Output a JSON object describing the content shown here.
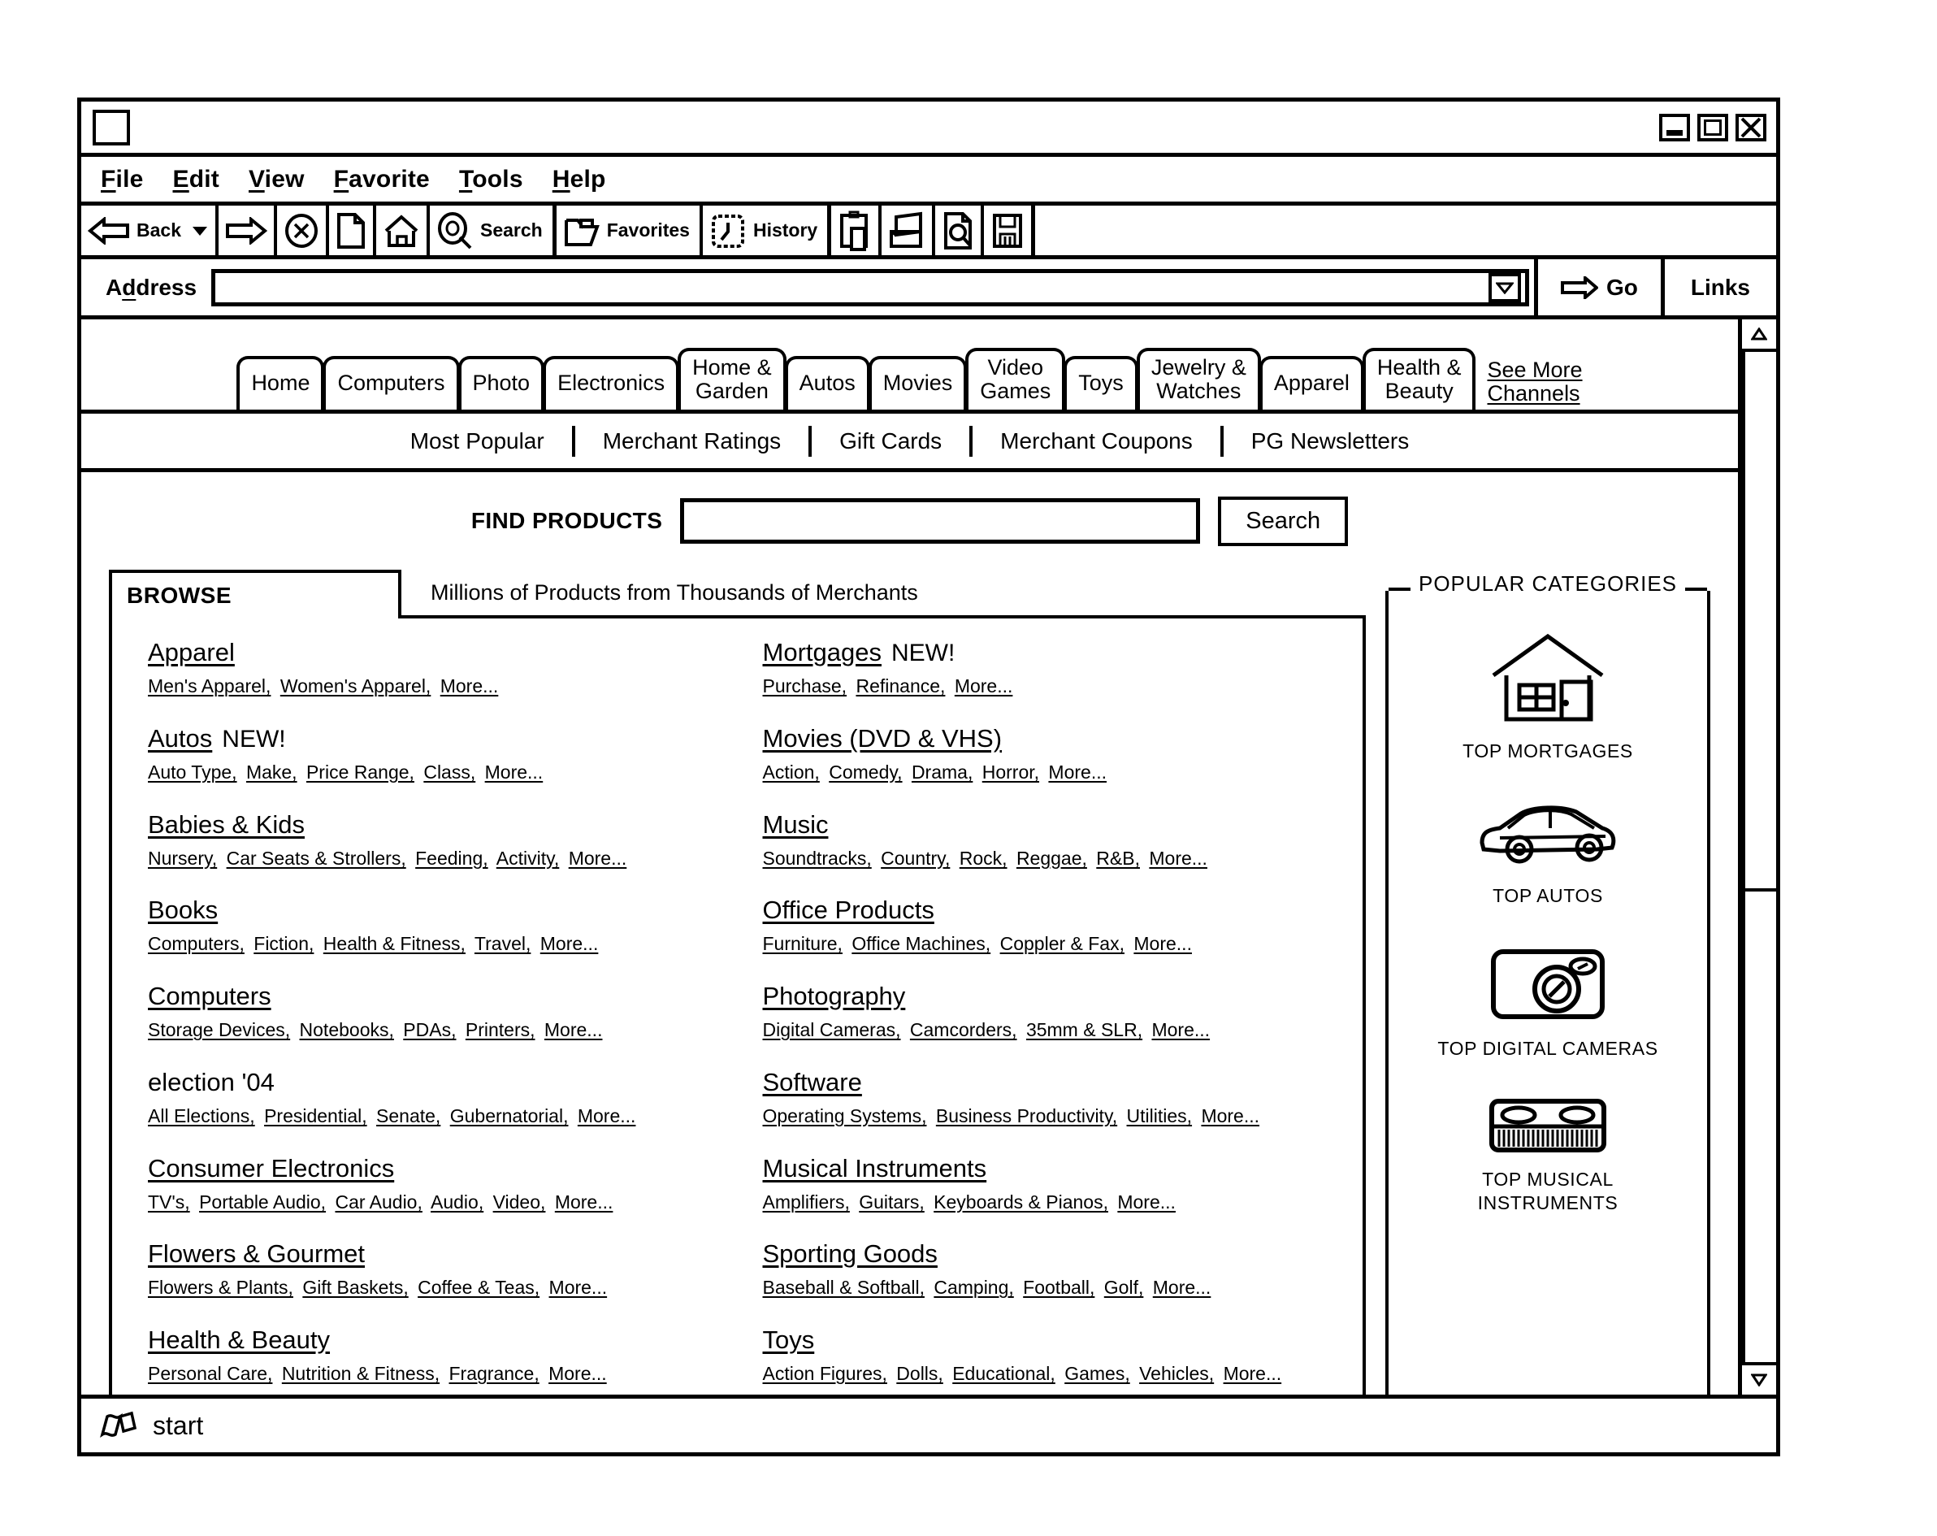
{
  "window": {
    "controls": {
      "minimize": "minimize-button",
      "maximize": "maximize-button",
      "close": "close-button"
    }
  },
  "menubar": {
    "items": [
      {
        "label": "File",
        "accel": "F"
      },
      {
        "label": "Edit",
        "accel": "E"
      },
      {
        "label": "View",
        "accel": "V"
      },
      {
        "label": "Favorite",
        "accel": "F"
      },
      {
        "label": "Tools",
        "accel": "T"
      },
      {
        "label": "Help",
        "accel": "H"
      }
    ]
  },
  "toolbar": {
    "back_label": "Back",
    "search_label": "Search",
    "favorites_label": "Favorites",
    "history_label": "History"
  },
  "addressbar": {
    "label": "Address",
    "value": "",
    "go_label": "Go",
    "links_label": "Links"
  },
  "channels": {
    "tabs": [
      "Home",
      "Computers",
      "Photo",
      "Electronics",
      "Home &\nGarden",
      "Autos",
      "Movies",
      "Video\nGames",
      "Toys",
      "Jewelry &\nWatches",
      "Apparel",
      "Health &\nBeauty"
    ],
    "see_more": "See More\nChannels"
  },
  "subnav": {
    "items": [
      "Most Popular",
      "Merchant Ratings",
      "Gift Cards",
      "Merchant Coupons",
      "PG Newsletters"
    ]
  },
  "find": {
    "label": "FIND PRODUCTS",
    "value": "",
    "placeholder": "",
    "button": "Search"
  },
  "browse": {
    "tab_label": "BROWSE",
    "tagline": "Millions of Products from Thousands of Merchants",
    "left_column": [
      {
        "title": "Apparel",
        "new": false,
        "underline": true,
        "links": [
          "Men's Apparel,",
          "Women's Apparel,",
          "More..."
        ]
      },
      {
        "title": "Autos",
        "new": true,
        "underline": true,
        "links": [
          "Auto Type,",
          "Make,",
          "Price Range,",
          "Class,",
          "More..."
        ]
      },
      {
        "title": "Babies & Kids",
        "new": false,
        "underline": true,
        "links": [
          "Nursery,",
          "Car Seats & Strollers,",
          "Feeding,",
          "Activity,",
          "More..."
        ]
      },
      {
        "title": "Books",
        "new": false,
        "underline": true,
        "links": [
          "Computers,",
          "Fiction,",
          "Health & Fitness,",
          "Travel,",
          "More..."
        ]
      },
      {
        "title": "Computers",
        "new": false,
        "underline": true,
        "links": [
          "Storage Devices,",
          "Notebooks,",
          "PDAs,",
          "Printers,",
          "More..."
        ]
      },
      {
        "title": "election '04",
        "new": false,
        "underline": false,
        "links": [
          "All Elections,",
          "Presidential,",
          "Senate,",
          "Gubernatorial,",
          "More..."
        ]
      },
      {
        "title": "Consumer Electronics",
        "new": false,
        "underline": true,
        "links": [
          "TV's,",
          "Portable Audio,",
          "Car Audio,",
          "Audio,",
          "Video,",
          "More..."
        ]
      },
      {
        "title": "Flowers & Gourmet",
        "new": false,
        "underline": true,
        "links": [
          "Flowers & Plants,",
          "Gift Baskets,",
          "Coffee & Teas,",
          "More..."
        ]
      },
      {
        "title": "Health & Beauty",
        "new": false,
        "underline": true,
        "links": [
          "Personal Care,",
          "Nutrition & Fitness,",
          "Fragrance,",
          "More..."
        ]
      }
    ],
    "right_column": [
      {
        "title": "Mortgages",
        "new": true,
        "underline": true,
        "links": [
          "Purchase,",
          "Refinance,",
          "More..."
        ]
      },
      {
        "title": "Movies (DVD & VHS)",
        "new": false,
        "underline": true,
        "links": [
          "Action,",
          "Comedy,",
          "Drama,",
          "Horror,",
          "More..."
        ]
      },
      {
        "title": "Music",
        "new": false,
        "underline": true,
        "links": [
          "Soundtracks,",
          "Country,",
          "Rock,",
          "Reggae,",
          "R&B,",
          "More..."
        ]
      },
      {
        "title": "Office Products",
        "new": false,
        "underline": true,
        "links": [
          "Furniture,",
          "Office Machines,",
          "Coppler & Fax,",
          "More..."
        ]
      },
      {
        "title": "Photography",
        "new": false,
        "underline": true,
        "links": [
          "Digital Cameras,",
          "Camcorders,",
          "35mm & SLR,",
          "More..."
        ]
      },
      {
        "title": "Software",
        "new": false,
        "underline": true,
        "links": [
          "Operating Systems,",
          "Business Productivity,",
          "Utilities,",
          "More..."
        ]
      },
      {
        "title": "Musical Instruments",
        "new": false,
        "underline": true,
        "links": [
          "Amplifiers,",
          "Guitars,",
          "Keyboards & Pianos,",
          "More..."
        ]
      },
      {
        "title": "Sporting Goods",
        "new": false,
        "underline": true,
        "links": [
          "Baseball & Softball,",
          "Camping,",
          "Football,",
          "Golf,",
          "More..."
        ]
      },
      {
        "title": "Toys",
        "new": false,
        "underline": true,
        "links": [
          "Action Figures,",
          "Dolls,",
          "Educational,",
          "Games,",
          "Vehicles,",
          "More..."
        ]
      }
    ]
  },
  "popular": {
    "title": "POPULAR CATEGORIES",
    "items": [
      {
        "icon": "house-icon",
        "label": "TOP MORTGAGES"
      },
      {
        "icon": "car-icon",
        "label": "TOP AUTOS"
      },
      {
        "icon": "camera-icon",
        "label": "TOP DIGITAL CAMERAS"
      },
      {
        "icon": "keyboard-icon",
        "label": "TOP MUSICAL\nINSTRUMENTS"
      }
    ]
  },
  "taskbar": {
    "start_label": "start"
  },
  "colors": {
    "ink": "#000000",
    "paper": "#ffffff"
  }
}
